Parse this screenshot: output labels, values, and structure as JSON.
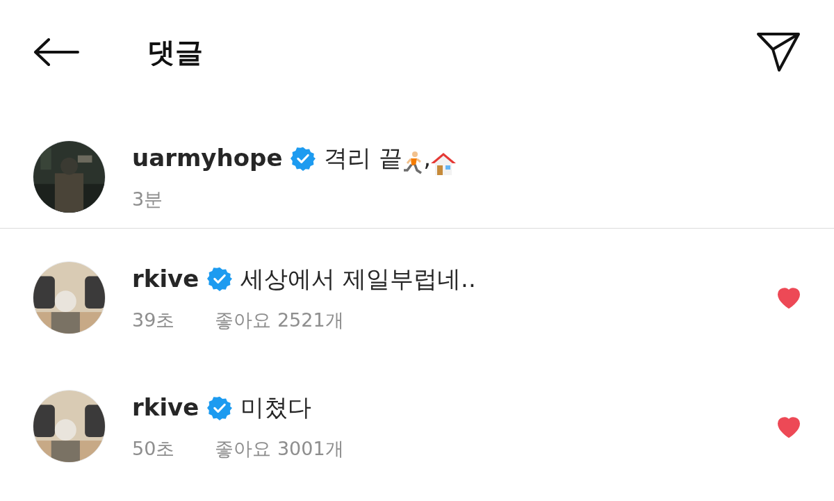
{
  "header": {
    "title": "댓글"
  },
  "caption": {
    "username": "uarmyhope",
    "verified": true,
    "text": "격리 끝",
    "separator": ",",
    "time": "3분"
  },
  "comments": [
    {
      "username": "rkive",
      "verified": true,
      "text": "세상에서 제일부럽네..",
      "time": "39초",
      "likes": "좋아요 2521개",
      "liked": true
    },
    {
      "username": "rkive",
      "verified": true,
      "text": "미쳤다",
      "time": "50초",
      "likes": "좋아요 3001개",
      "liked": true
    }
  ]
}
